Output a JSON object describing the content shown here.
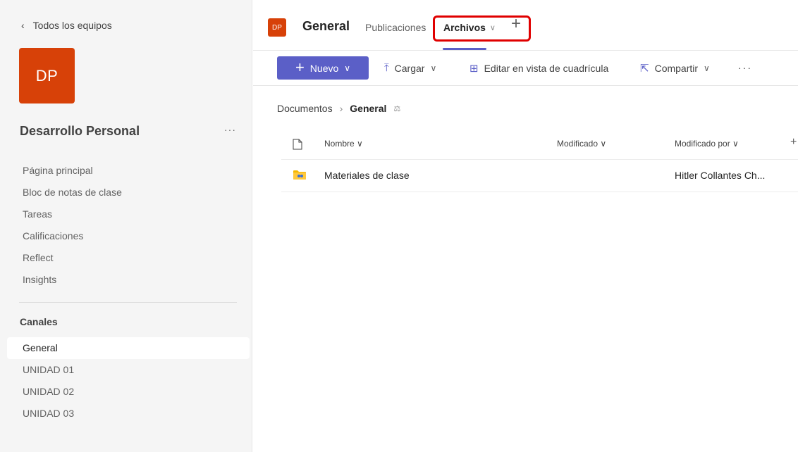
{
  "sidebar": {
    "back_label": "Todos los equipos",
    "team_initials": "DP",
    "team_name": "Desarrollo Personal",
    "more_label": "···",
    "nav_items": [
      "Página principal",
      "Bloc de notas de clase",
      "Tareas",
      "Calificaciones",
      "Reflect",
      "Insights"
    ],
    "channels_title": "Canales",
    "channels": [
      "General",
      "UNIDAD 01",
      "UNIDAD 02",
      "UNIDAD 03"
    ],
    "active_channel": "General"
  },
  "header": {
    "channel_initials": "DP",
    "channel_title": "General",
    "tabs": [
      {
        "label": "Publicaciones"
      },
      {
        "label": "Archivos",
        "active": true
      }
    ],
    "add_tab_icon": "plus-icon",
    "highlight_color": "#e00000"
  },
  "toolbar": {
    "new_label": "Nuevo",
    "upload_label": "Cargar",
    "grid_label": "Editar en vista de cuadrícula",
    "share_label": "Compartir",
    "more_label": "···",
    "accent_color": "#5b5fc7"
  },
  "breadcrumb": {
    "root": "Documentos",
    "current": "General"
  },
  "files": {
    "columns": {
      "name": "Nombre",
      "modified": "Modificado",
      "modified_by": "Modificado por"
    },
    "rows": [
      {
        "name": "Materiales de clase",
        "modified": "",
        "modified_by": "Hitler Collantes Ch..."
      }
    ]
  },
  "colors": {
    "brand_team": "#d74108",
    "accent": "#5b5fc7"
  }
}
